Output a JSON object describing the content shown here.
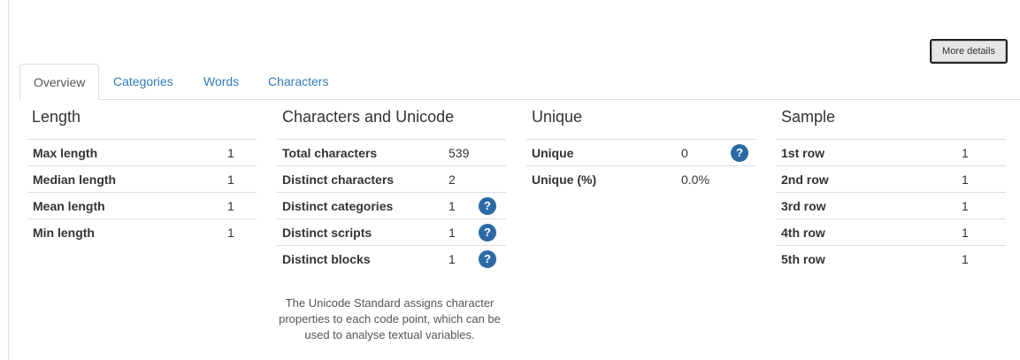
{
  "top_fragment": "",
  "more_details_label": "More details",
  "tabs": [
    {
      "label": "Overview",
      "active": true
    },
    {
      "label": "Categories",
      "active": false
    },
    {
      "label": "Words",
      "active": false
    },
    {
      "label": "Characters",
      "active": false
    }
  ],
  "length": {
    "title": "Length",
    "rows": [
      {
        "label": "Max length",
        "value": "1"
      },
      {
        "label": "Median length",
        "value": "1"
      },
      {
        "label": "Mean length",
        "value": "1"
      },
      {
        "label": "Min length",
        "value": "1"
      }
    ]
  },
  "characters_unicode": {
    "title": "Characters and Unicode",
    "rows": [
      {
        "label": "Total characters",
        "value": "539",
        "help": false
      },
      {
        "label": "Distinct characters",
        "value": "2",
        "help": false
      },
      {
        "label": "Distinct categories",
        "value": "1",
        "help": true
      },
      {
        "label": "Distinct scripts",
        "value": "1",
        "help": true
      },
      {
        "label": "Distinct blocks",
        "value": "1",
        "help": true
      }
    ],
    "note": "The Unicode Standard assigns character properties to each code point, which can be used to analyse textual variables."
  },
  "unique": {
    "title": "Unique",
    "rows": [
      {
        "label": "Unique",
        "value": "0",
        "help": true
      },
      {
        "label": "Unique (%)",
        "value": "0.0%",
        "help": false
      }
    ]
  },
  "sample": {
    "title": "Sample",
    "rows": [
      {
        "label": "1st row",
        "value": "1"
      },
      {
        "label": "2nd row",
        "value": "1"
      },
      {
        "label": "3rd row",
        "value": "1"
      },
      {
        "label": "4th row",
        "value": "1"
      },
      {
        "label": "5th row",
        "value": "1"
      }
    ]
  },
  "help_glyph": "?",
  "colors": {
    "link": "#337ab7",
    "help_badge": "#2c6aa6",
    "border": "#dddddd"
  }
}
